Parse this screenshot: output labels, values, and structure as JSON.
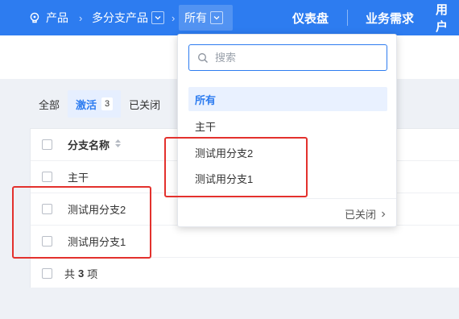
{
  "colors": {
    "primary": "#2d7cf0",
    "highlight": "#e3312d",
    "background": "#eef1f6"
  },
  "topbar": {
    "breadcrumb": {
      "product_icon": "lightbulb-icon",
      "product": "产品",
      "program": "多分支产品",
      "branch": "所有"
    },
    "nav": [
      "仪表盘",
      "业务需求",
      "用户"
    ]
  },
  "filters": {
    "all": "全部",
    "active": "激活",
    "active_count": "3",
    "closed": "已关闭"
  },
  "table": {
    "header": "分支名称",
    "rows": [
      "主干",
      "测试用分支2",
      "测试用分支1"
    ],
    "footer_prefix": "共",
    "footer_count": "3",
    "footer_suffix": "项"
  },
  "dropdown": {
    "search_placeholder": "搜索",
    "items": [
      "所有",
      "主干",
      "测试用分支2",
      "测试用分支1"
    ],
    "closed_link": "已关闭"
  }
}
